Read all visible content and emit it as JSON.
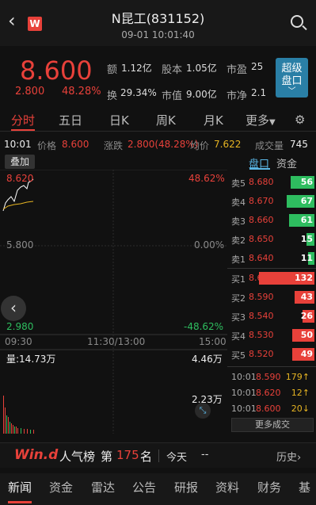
{
  "header": {
    "back": "‹",
    "logo": "W",
    "title": "N昆工(831152)",
    "time": "09-01 10:01:40"
  },
  "quote": {
    "price": "8.600",
    "change": "2.800",
    "change_pct": "48.28%",
    "stats": [
      {
        "label": "额",
        "value": "1.12亿"
      },
      {
        "label": "股本",
        "value": "1.05亿"
      },
      {
        "label": "市盈",
        "value": "25"
      },
      {
        "label": "换",
        "value": "29.34%"
      },
      {
        "label": "市值",
        "value": "9.00亿"
      },
      {
        "label": "市净",
        "value": "2.1"
      }
    ],
    "super_btn_line1": "超级",
    "super_btn_line2": "盘口"
  },
  "tabs": [
    "分时",
    "五日",
    "日K",
    "周K",
    "月K",
    "更多"
  ],
  "info": {
    "time": "10:01",
    "price_label": "价格",
    "price": "8.600",
    "chg_label": "涨跌",
    "chg": "2.800(48.28%)",
    "avg_label": "均价",
    "avg": "7.622",
    "vol_label": "成交量",
    "vol": "745"
  },
  "add_btn": "叠加",
  "chart": {
    "top_price": "8.620",
    "top_pct": "48.62%",
    "mid_price": "5.800",
    "mid_pct": "0.00%",
    "bot_price": "2.980",
    "bot_pct": "-48.62%",
    "t_start": "09:30",
    "t_mid": "11:30/13:00",
    "t_end": "15:00",
    "vol_label": "量:14.73万",
    "vol_max": "4.46万",
    "vol_mid": "2.23万"
  },
  "orderbook": {
    "tabs": [
      "盘口",
      "资金"
    ],
    "asks": [
      {
        "label": "卖5",
        "price": "8.680",
        "vol": "56",
        "color": "#2ebd5f",
        "pct": 0.3
      },
      {
        "label": "卖4",
        "price": "8.670",
        "vol": "67",
        "color": "#2ebd5f",
        "pct": 0.35
      },
      {
        "label": "卖3",
        "price": "8.660",
        "vol": "61",
        "color": "#2ebd5f",
        "pct": 0.32
      },
      {
        "label": "卖2",
        "price": "8.650",
        "vol": "15",
        "color": "#2ebd5f",
        "pct": 0.1
      },
      {
        "label": "卖1",
        "price": "8.640",
        "vol": "11",
        "color": "#2ebd5f",
        "pct": 0.08
      }
    ],
    "bids": [
      {
        "label": "买1",
        "price": "8.600",
        "vol": "132",
        "color": "#e8413a",
        "pct": 0.7
      },
      {
        "label": "买2",
        "price": "8.590",
        "vol": "43",
        "color": "#e8413a",
        "pct": 0.25
      },
      {
        "label": "买3",
        "price": "8.540",
        "vol": "26",
        "color": "#e8413a",
        "pct": 0.15
      },
      {
        "label": "买4",
        "price": "8.530",
        "vol": "50",
        "color": "#e8413a",
        "pct": 0.28
      },
      {
        "label": "买5",
        "price": "8.520",
        "vol": "49",
        "color": "#e8413a",
        "pct": 0.28
      }
    ],
    "trades": [
      {
        "time": "10:01",
        "price": "8.590",
        "vol": "179↑"
      },
      {
        "time": "10:01",
        "price": "8.620",
        "vol": "12↑"
      },
      {
        "time": "10:01",
        "price": "8.600",
        "vol": "20↓"
      }
    ],
    "more": "更多成交"
  },
  "wind": {
    "logo": "Win.d",
    "label": "人气榜",
    "rank_prefix": "第",
    "rank": "175",
    "rank_suffix": "名",
    "period": "今天",
    "period_value": "--",
    "history": "历史"
  },
  "bottom_nav": [
    "新闻",
    "资金",
    "雷达",
    "公告",
    "研报",
    "资料",
    "财务",
    "基"
  ],
  "colors": {
    "up": "#e8413a",
    "down": "#2ebd5f",
    "accent": "#2a7fa6"
  }
}
